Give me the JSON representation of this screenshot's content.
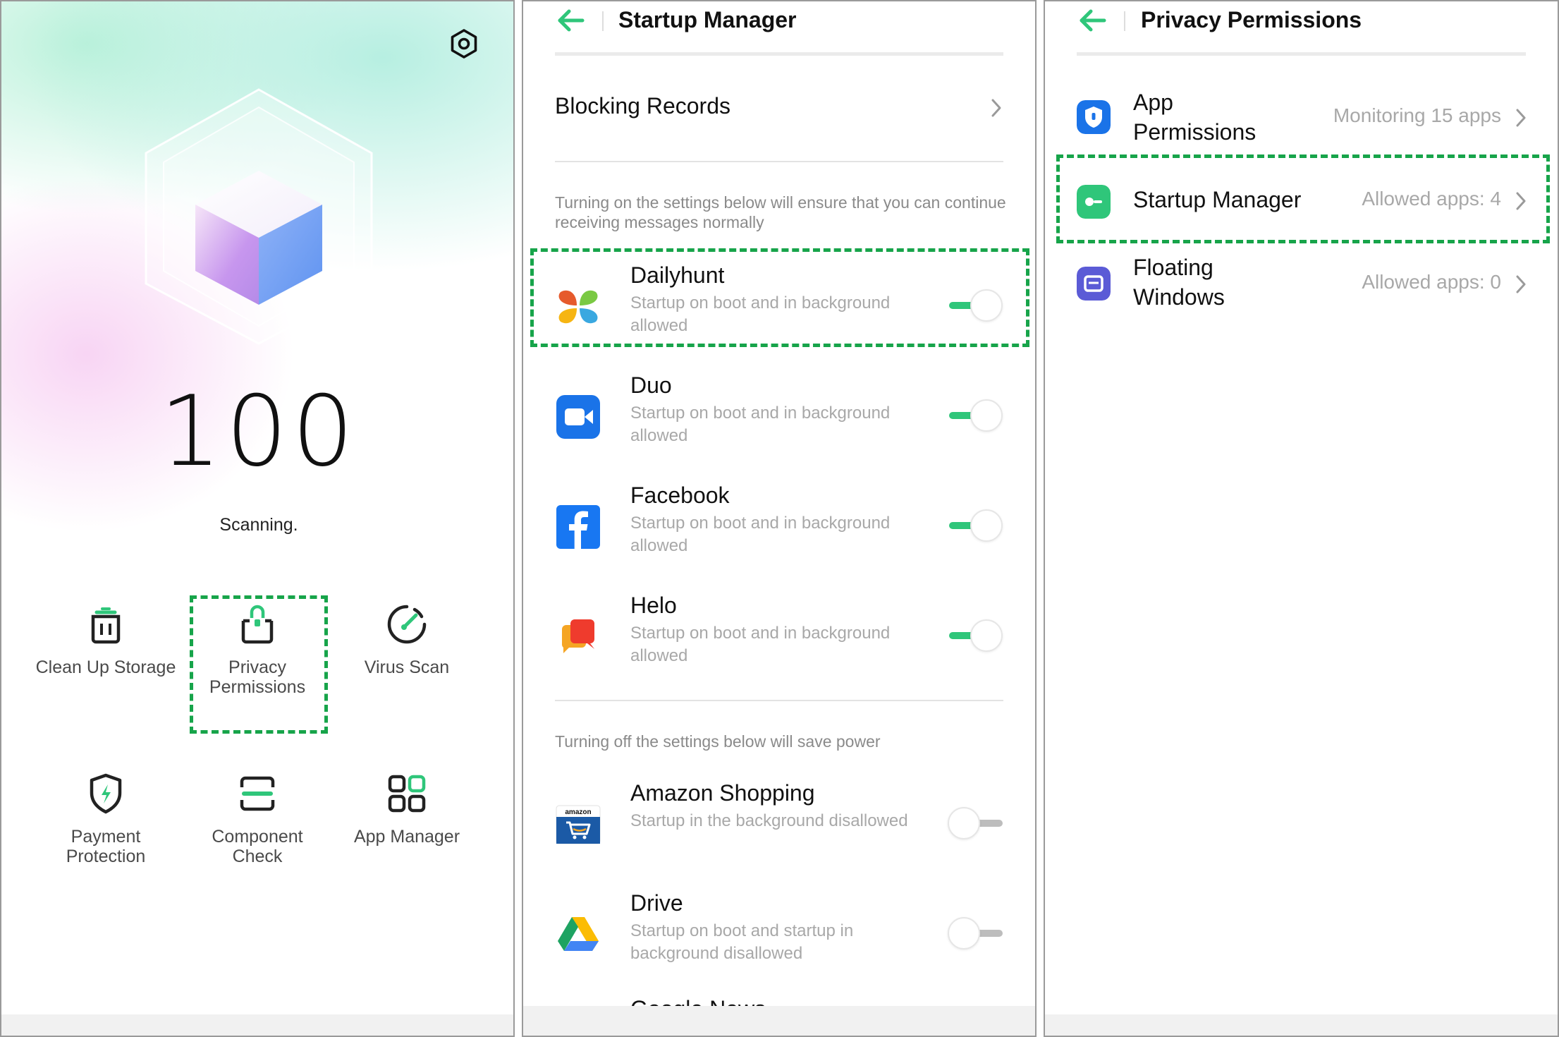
{
  "colors": {
    "accent": "#2fc67a",
    "highlight": "#17a44a",
    "hint": "#8a8a8a",
    "value": "#a8a8a8"
  },
  "home": {
    "score": "100",
    "status": "Scanning.",
    "tools": [
      {
        "label": "Clean Up Storage",
        "icon": "trash-icon"
      },
      {
        "label_lines": [
          "Privacy",
          "Permissions"
        ],
        "icon": "lock-bag-icon"
      },
      {
        "label": "Virus Scan",
        "icon": "speedometer-icon"
      },
      {
        "label_lines": [
          "Payment",
          "Protection"
        ],
        "icon": "shield-bolt-icon"
      },
      {
        "label_lines": [
          "Component",
          "Check"
        ],
        "icon": "scan-frame-icon"
      },
      {
        "label": "App Manager",
        "icon": "app-grid-icon"
      }
    ]
  },
  "startup": {
    "title": "Startup Manager",
    "blocking_records": "Blocking Records",
    "hint_on": "Turning on the settings below will ensure that you can continue receiving messages normally",
    "hint_off": "Turning off the settings below will save power",
    "allowed_apps": [
      {
        "name": "Dailyhunt",
        "sub": "Startup on boot and in background allowed",
        "enabled": true
      },
      {
        "name": "Duo",
        "sub": "Startup on boot and in background allowed",
        "enabled": true
      },
      {
        "name": "Facebook",
        "sub": "Startup on boot and in background allowed",
        "enabled": true
      },
      {
        "name": "Helo",
        "sub": "Startup on boot and in background allowed",
        "enabled": true
      }
    ],
    "disallowed_apps": [
      {
        "name": "Amazon Shopping",
        "sub": "Startup in the background disallowed",
        "enabled": false,
        "icon_text": "amazon"
      },
      {
        "name": "Drive",
        "sub": "Startup on boot and startup in background disallowed",
        "enabled": false
      },
      {
        "name": "Google News"
      }
    ]
  },
  "privacy": {
    "title": "Privacy Permissions",
    "items": [
      {
        "name_lines": [
          "App",
          "Permissions"
        ],
        "value": "Monitoring 15 apps"
      },
      {
        "name": "Startup Manager",
        "value": "Allowed apps: 4"
      },
      {
        "name_lines": [
          "Floating",
          "Windows"
        ],
        "value": "Allowed apps: 0"
      }
    ]
  }
}
